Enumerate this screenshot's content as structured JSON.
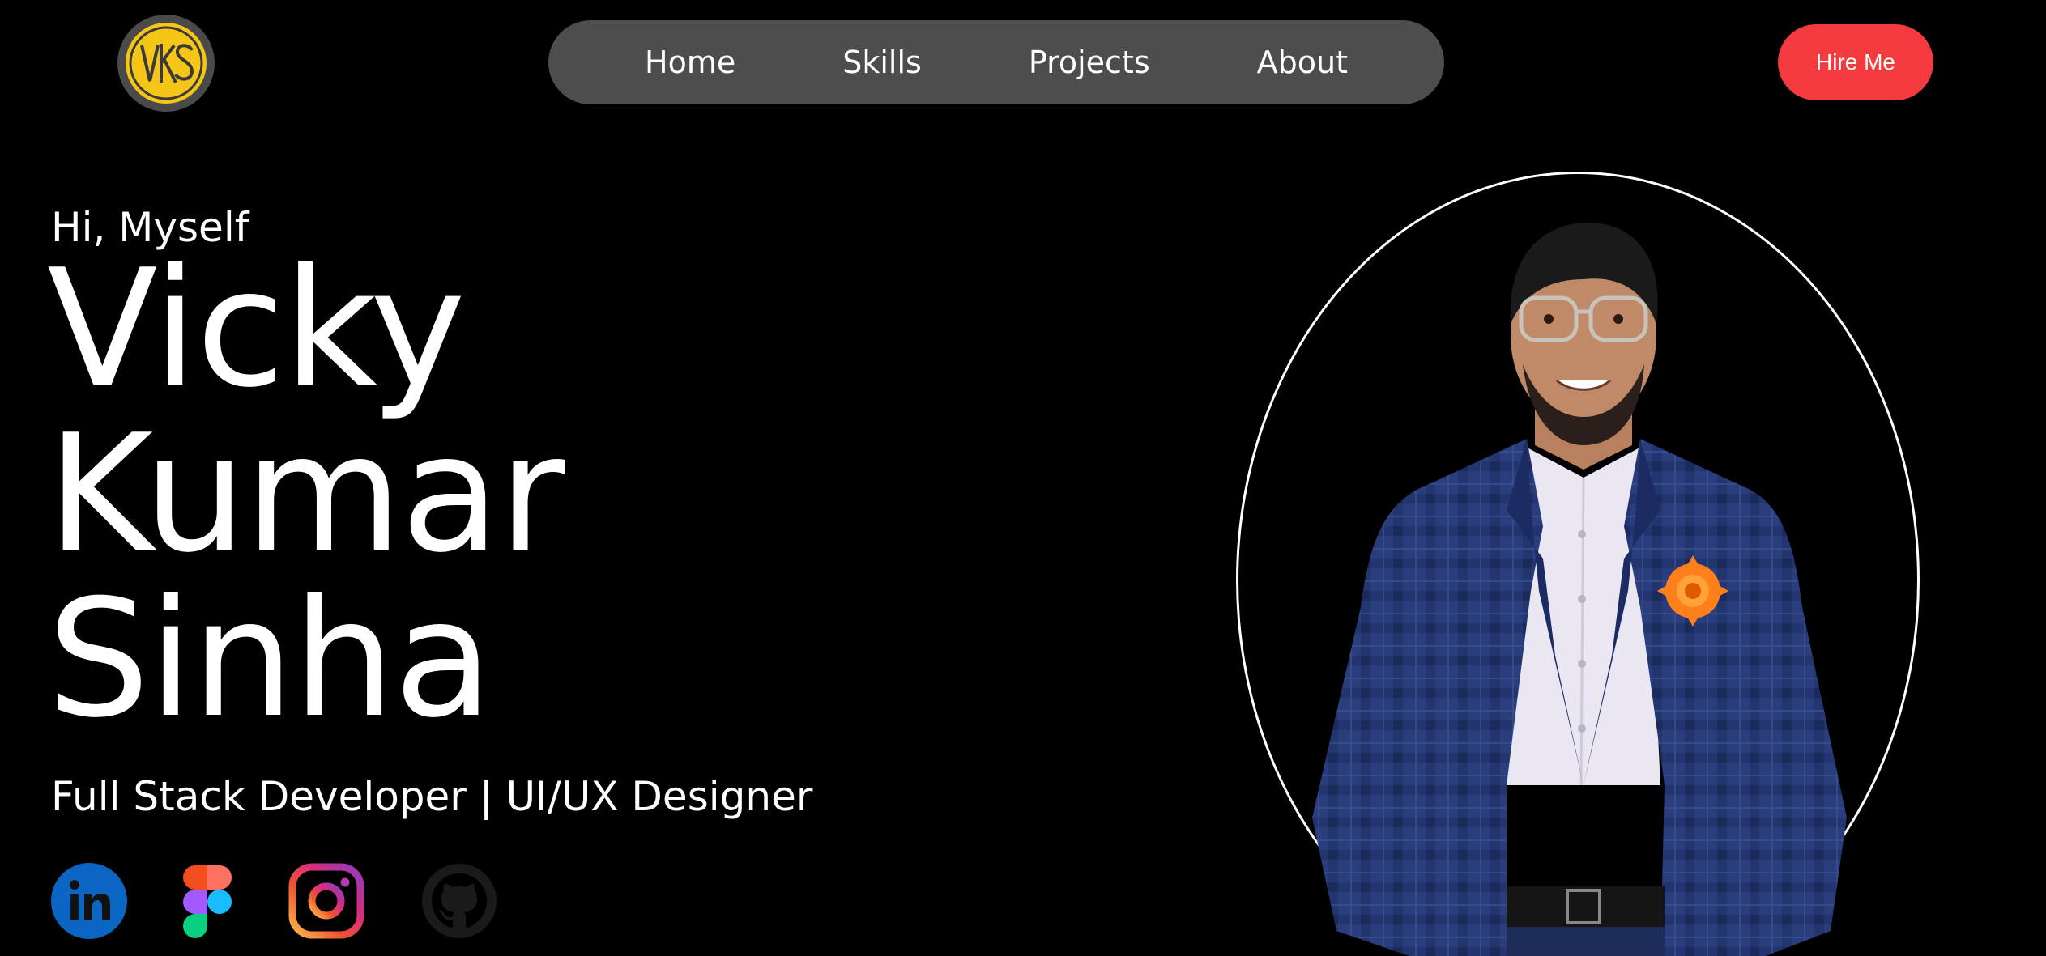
{
  "brand": {
    "logo_icon": "vks-monogram-logo",
    "logo_text": "VKS",
    "logo_color": "#f5c518"
  },
  "nav": {
    "items": [
      {
        "label": "Home"
      },
      {
        "label": "Skills"
      },
      {
        "label": "Projects"
      },
      {
        "label": "About"
      }
    ]
  },
  "header": {
    "cta_label": "Hire Me",
    "cta_color": "#f23a3f"
  },
  "hero": {
    "greeting": "Hi, Myself",
    "name_lines": [
      "Vicky",
      "Kumar",
      "Sinha"
    ],
    "role": "Full Stack Developer | UI/UX Designer",
    "portrait_icon": "profile-portrait"
  },
  "social": [
    {
      "name": "linkedin-icon",
      "color": "#0a66c2"
    },
    {
      "name": "figma-icon",
      "color": "#a259ff"
    },
    {
      "name": "instagram-icon",
      "color": "#e1306c"
    },
    {
      "name": "github-icon",
      "color": "#1a1a1a"
    }
  ]
}
